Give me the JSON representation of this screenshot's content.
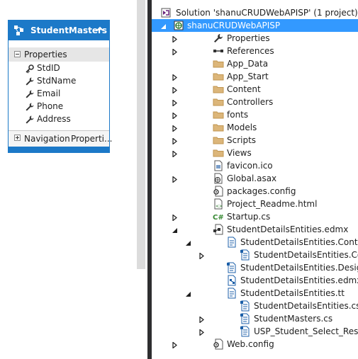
{
  "entity": {
    "title": "StudentMasters",
    "properties_label": "Properties",
    "properties": [
      {
        "name": "StdID",
        "icon": "key-icon"
      },
      {
        "name": "StdName",
        "icon": "wrench-icon"
      },
      {
        "name": "Email",
        "icon": "wrench-icon"
      },
      {
        "name": "Phone",
        "icon": "wrench-icon"
      },
      {
        "name": "Address",
        "icon": "wrench-icon"
      }
    ],
    "navigation_label": "Navigation",
    "navigation_value": "Properti...",
    "accent_color": "#1c79c8"
  },
  "solution_explorer": {
    "selected_color": "#3399ff",
    "items": [
      {
        "label": "Solution 'shanuCRUDWebAPISP' (1 project)",
        "icon": "solution-icon",
        "expander": "none",
        "indent": 0
      },
      {
        "label": "shanuCRUDWebAPISP",
        "icon": "web-project-icon",
        "expander": "expanded",
        "indent": 0,
        "selected": true
      },
      {
        "label": "Properties",
        "icon": "wrench-icon",
        "expander": "collapsed",
        "indent": 1
      },
      {
        "label": "References",
        "icon": "references-icon",
        "expander": "collapsed",
        "indent": 1
      },
      {
        "label": "App_Data",
        "icon": "folder-icon",
        "expander": "none",
        "indent": 1
      },
      {
        "label": "App_Start",
        "icon": "folder-icon",
        "expander": "collapsed",
        "indent": 1
      },
      {
        "label": "Content",
        "icon": "folder-icon",
        "expander": "collapsed",
        "indent": 1
      },
      {
        "label": "Controllers",
        "icon": "folder-icon",
        "expander": "collapsed",
        "indent": 1
      },
      {
        "label": "fonts",
        "icon": "folder-icon",
        "expander": "collapsed",
        "indent": 1
      },
      {
        "label": "Models",
        "icon": "folder-icon",
        "expander": "collapsed",
        "indent": 1
      },
      {
        "label": "Scripts",
        "icon": "folder-icon",
        "expander": "collapsed",
        "indent": 1
      },
      {
        "label": "Views",
        "icon": "folder-icon",
        "expander": "collapsed",
        "indent": 1
      },
      {
        "label": "favicon.ico",
        "icon": "image-file-icon",
        "expander": "none",
        "indent": 1
      },
      {
        "label": "Global.asax",
        "icon": "global-asax-icon",
        "expander": "collapsed",
        "indent": 1
      },
      {
        "label": "packages.config",
        "icon": "config-file-icon",
        "expander": "none",
        "indent": 1
      },
      {
        "label": "Project_Readme.html",
        "icon": "html-file-icon",
        "expander": "none",
        "indent": 1
      },
      {
        "label": "Startup.cs",
        "icon": "csharp-file-icon",
        "expander": "collapsed",
        "indent": 1
      },
      {
        "label": "StudentDetailsEntities.edmx",
        "icon": "edmx-file-icon",
        "expander": "expanded",
        "indent": 1
      },
      {
        "label": "StudentDetailsEntities.Context.tt",
        "icon": "tt-file-icon",
        "expander": "expanded",
        "indent": 2
      },
      {
        "label": "StudentDetailsEntities.Context.cs",
        "icon": "cs-doc-icon",
        "expander": "collapsed",
        "indent": 3
      },
      {
        "label": "StudentDetailsEntities.Designer.cs",
        "icon": "cs-doc-icon",
        "expander": "none",
        "indent": 2
      },
      {
        "label": "StudentDetailsEntities.edmx.diagram",
        "icon": "diagram-file-icon",
        "expander": "none",
        "indent": 2
      },
      {
        "label": "StudentDetailsEntities.tt",
        "icon": "tt-file-icon",
        "expander": "expanded",
        "indent": 2
      },
      {
        "label": "StudentDetailsEntities.cs",
        "icon": "cs-doc-icon",
        "expander": "none",
        "indent": 3
      },
      {
        "label": "StudentMasters.cs",
        "icon": "cs-doc-icon",
        "expander": "collapsed",
        "indent": 3
      },
      {
        "label": "USP_Student_Select_Result.cs",
        "icon": "cs-doc-icon",
        "expander": "collapsed",
        "indent": 3
      },
      {
        "label": "Web.config",
        "icon": "config-file-icon",
        "expander": "collapsed",
        "indent": 1
      }
    ]
  }
}
